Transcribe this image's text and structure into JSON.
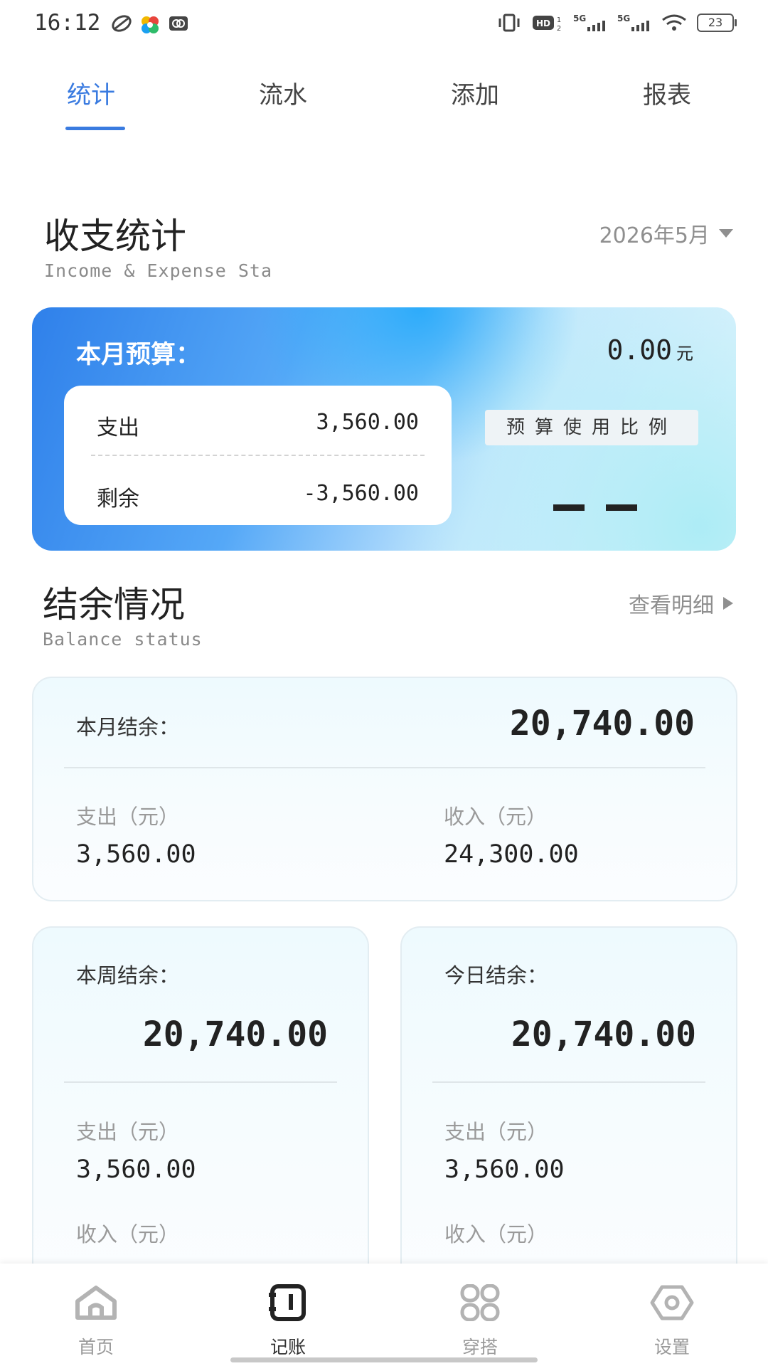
{
  "status_bar": {
    "time": "16:12",
    "battery": "23",
    "icons": [
      "vibrate-icon",
      "hd-icon",
      "signal-5g-icon",
      "signal-5g-icon",
      "wifi-icon"
    ]
  },
  "tabs": [
    {
      "label": "统计",
      "active": true
    },
    {
      "label": "流水",
      "active": false
    },
    {
      "label": "添加",
      "active": false
    },
    {
      "label": "报表",
      "active": false
    }
  ],
  "stats_section": {
    "title": "收支统计",
    "subtitle": "Income & Expense Sta",
    "month_selector": "2026年5月"
  },
  "budget_card": {
    "label": "本月预算：",
    "amount": "0.00",
    "unit": "元",
    "expense_label": "支出",
    "expense_value": "3,560.00",
    "remaining_label": "剩余",
    "remaining_value": "-3,560.00",
    "ratio_label": "预算使用比例"
  },
  "balance_section": {
    "title": "结余情况",
    "subtitle": "Balance status",
    "detail_link": "查看明细"
  },
  "month_card": {
    "label": "本月结余：",
    "balance": "20,740.00",
    "expense_label": "支出（元）",
    "expense_value": "3,560.00",
    "income_label": "收入（元）",
    "income_value": "24,300.00"
  },
  "week_card": {
    "label": "本周结余：",
    "balance": "20,740.00",
    "expense_label": "支出（元）",
    "expense_value": "3,560.00",
    "income_label": "收入（元）"
  },
  "today_card": {
    "label": "今日结余：",
    "balance": "20,740.00",
    "expense_label": "支出（元）",
    "expense_value": "3,560.00",
    "income_label": "收入（元）"
  },
  "bottom_nav": [
    {
      "label": "首页",
      "icon": "home-icon",
      "active": false
    },
    {
      "label": "记账",
      "icon": "ledger-icon",
      "active": true
    },
    {
      "label": "穿搭",
      "icon": "grid-icon",
      "active": false
    },
    {
      "label": "设置",
      "icon": "settings-icon",
      "active": false
    }
  ],
  "colors": {
    "accent": "#3a7be0",
    "text": "#222222",
    "muted": "#9a9a9a"
  }
}
